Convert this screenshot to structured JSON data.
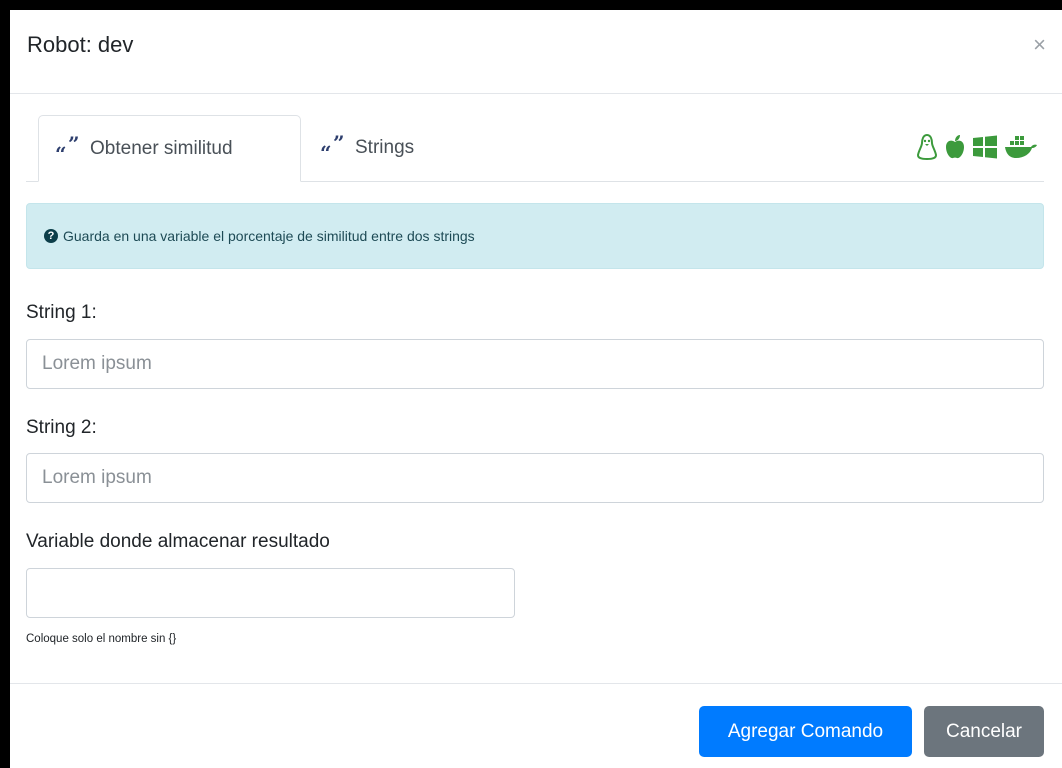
{
  "modal": {
    "title": "Robot: dev",
    "close_label": "×"
  },
  "tabs": [
    {
      "label": "Obtener similitud",
      "icon": "quote-icon",
      "active": true
    },
    {
      "label": "Strings",
      "icon": "quote-icon",
      "active": false
    }
  ],
  "os_icons": [
    "linux-icon",
    "apple-icon",
    "windows-icon",
    "docker-icon"
  ],
  "colors": {
    "os_icon_green": "#3c9a3c",
    "primary": "#007bff",
    "secondary": "#6c757d",
    "alert_bg": "#d1ecf1"
  },
  "alert": {
    "icon": "question-circle-icon",
    "text": "Guarda en una variable el porcentaje de similitud entre dos strings"
  },
  "form": {
    "string1_label": "String 1:",
    "string1_placeholder": "Lorem ipsum",
    "string1_value": "",
    "string2_label": "String 2:",
    "string2_placeholder": "Lorem ipsum",
    "string2_value": "",
    "variable_label": "Variable donde almacenar resultado",
    "variable_value": "",
    "variable_help": "Coloque solo el nombre sin {}"
  },
  "footer": {
    "submit_label": "Agregar Comando",
    "cancel_label": "Cancelar"
  }
}
